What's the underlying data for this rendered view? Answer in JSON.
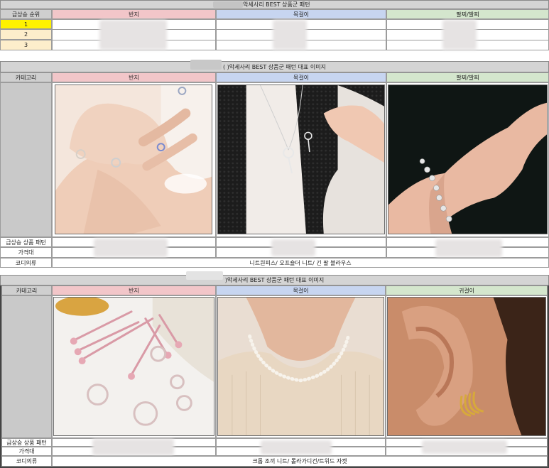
{
  "section1": {
    "title": ") 악세사리 BEST 상품군 패턴",
    "rank_header": "급상승 순위",
    "columns": [
      "반지",
      "목걸이",
      "팔찌/발찌"
    ],
    "ranks": [
      "1",
      "2",
      "3"
    ]
  },
  "section2": {
    "title": "(   )악세사리 BEST 상품군 패턴 대표 이미지",
    "category_label": "카테고리",
    "columns": [
      "반지",
      "목걸이",
      "팔찌/발찌"
    ],
    "row_labels": [
      "급상승 상품 패턴",
      "가격대",
      "코디의류"
    ],
    "coordi": "니트원피스/ 오프숄더 니트/ 긴 팔 블라우스"
  },
  "section3": {
    "title": ")악세사리 BEST 상품군 패턴 대표 이미지",
    "category_label": "카테고리",
    "columns": [
      "반지",
      "목걸이",
      "귀걸이"
    ],
    "row_labels": [
      "급상승 상품 패턴",
      "가격대",
      "코디의류"
    ],
    "coordi": "크롭 조끼 니트/ 롤라가디건/트위드 자켓"
  },
  "icons": [
    "ring-photo",
    "key-necklace-photo",
    "bracelet-photo",
    "pink-rings-photo",
    "pearl-necklace-photo",
    "gold-earring-photo"
  ]
}
